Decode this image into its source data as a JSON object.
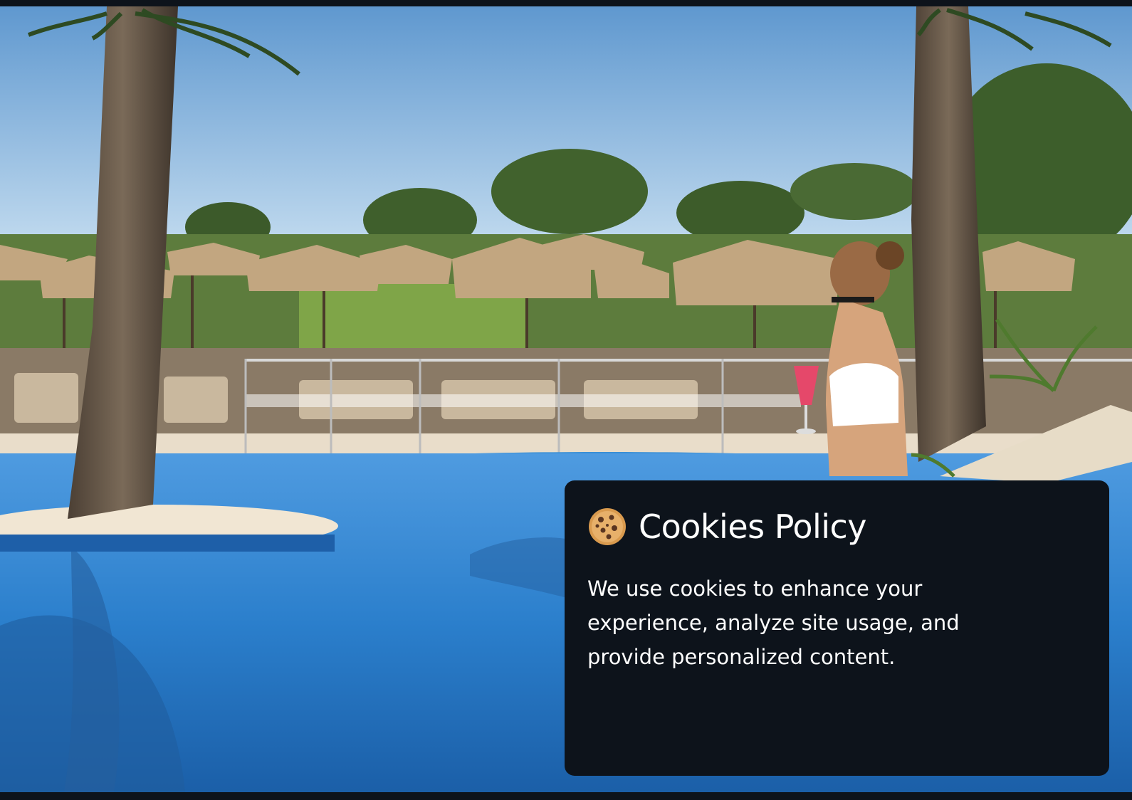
{
  "background": {
    "description_icon": "resort-pool-photo"
  },
  "cookie_banner": {
    "icon": "cookie-icon",
    "title": "Cookies Policy",
    "body": "We use cookies to enhance your experience, analyze site usage, and provide personalized content."
  },
  "colors": {
    "banner_bg": "#0d131b",
    "text": "#ffffff"
  }
}
